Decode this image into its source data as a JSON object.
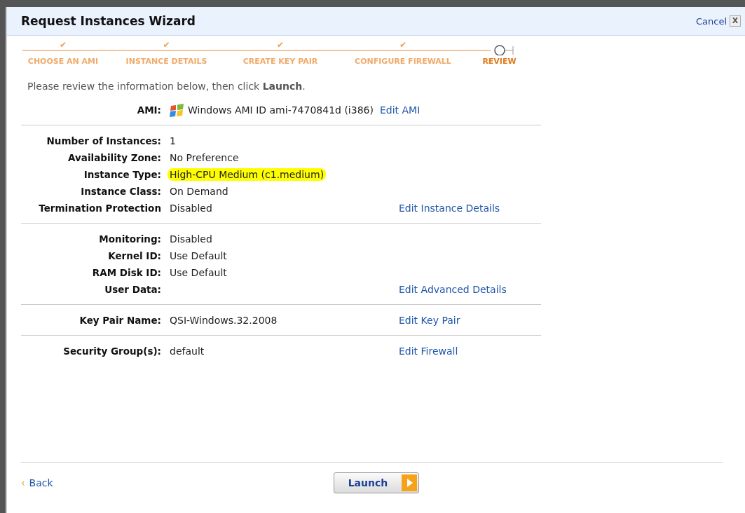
{
  "window": {
    "title": "Request Instances Wizard",
    "cancel": "Cancel",
    "close": "X"
  },
  "steps": [
    {
      "label": "CHOOSE AN AMI",
      "check": "✔",
      "selected": false
    },
    {
      "label": "INSTANCE DETAILS",
      "check": "✔",
      "selected": false
    },
    {
      "label": "CREATE KEY PAIR",
      "check": "✔",
      "selected": false
    },
    {
      "label": "CONFIGURE FIREWALL",
      "check": "✔",
      "selected": false
    },
    {
      "label": "REVIEW",
      "selected": true
    }
  ],
  "intro": "Please review the information below, then click **Launch**.",
  "sections": [
    {
      "kind": "inline",
      "rows": [
        {
          "label": "AMI:",
          "value": "Windows AMI ID ami-7470841d (i386)",
          "highlighted": false
        }
      ],
      "edit_link": "Edit AMI"
    },
    {
      "kind": "column",
      "rows": [
        {
          "label": "Number of Instances:",
          "value": "1",
          "highlighted": false
        },
        {
          "label": "Availability Zone:",
          "value": "No Preference",
          "highlighted": false
        },
        {
          "label": "Instance Type:",
          "value": "High-CPU Medium (c1.medium)",
          "highlighted": true
        },
        {
          "label": "Instance Class:",
          "value": "On Demand",
          "highlighted": false
        },
        {
          "label": "Termination Protection",
          "value": "Disabled",
          "highlighted": false
        }
      ],
      "edit_link": "Edit Instance Details"
    },
    {
      "kind": "column",
      "rows": [
        {
          "label": "Monitoring:",
          "value": "Disabled",
          "highlighted": false
        },
        {
          "label": "Kernel ID:",
          "value": "Use Default",
          "highlighted": false
        },
        {
          "label": "RAM Disk ID:",
          "value": "Use Default",
          "highlighted": false
        },
        {
          "label": "User Data:"
        }
      ],
      "edit_link": "Edit Advanced Details"
    },
    {
      "kind": "column",
      "rows": [
        {
          "label": "Key Pair Name:",
          "value": "QSI-Windows.32.2008",
          "highlighted": false
        }
      ],
      "edit_link": "Edit Key Pair"
    },
    {
      "kind": "column",
      "rows": [
        {
          "label": "Security Group(s):",
          "value": "default",
          "highlighted": false
        }
      ],
      "edit_link": "Edit Firewall"
    }
  ],
  "footer": {
    "back": "Back",
    "back_caret": "‹",
    "launch": "Launch"
  }
}
